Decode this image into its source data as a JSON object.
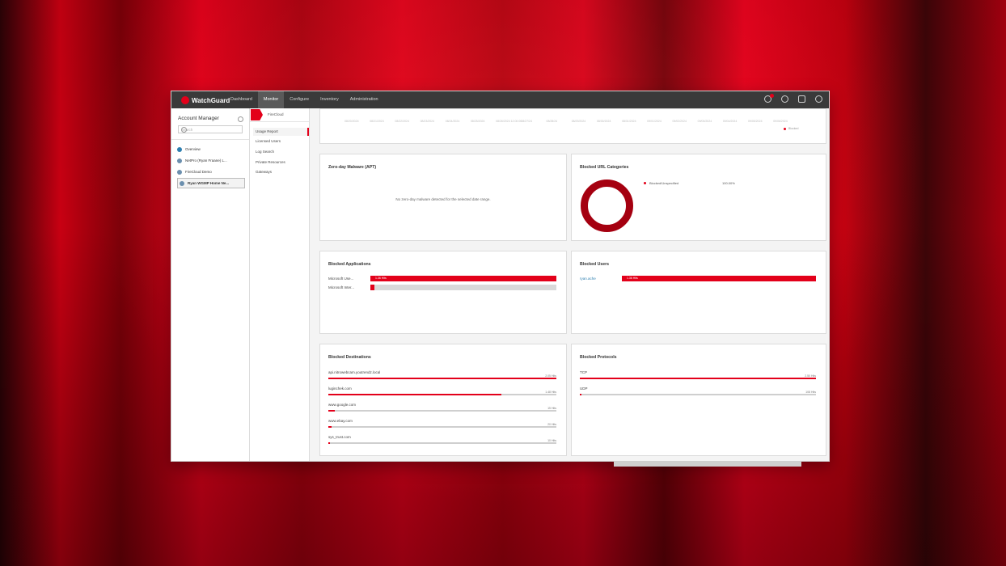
{
  "app": {
    "logo_text": "WatchGuard"
  },
  "nav": {
    "items": [
      "Dashboard",
      "Monitor",
      "Configure",
      "Inventory",
      "Administration"
    ],
    "active_index": 1
  },
  "top_icons": [
    "notifications-icon",
    "help-icon",
    "phone-icon",
    "globe-icon"
  ],
  "account_manager": {
    "title": "Account Manager",
    "search_placeholder": "Search",
    "accounts": [
      {
        "label": "Overview",
        "icon": "cloud-icon",
        "selected": false
      },
      {
        "label": "NetPro (Ryan Fraane) L...",
        "icon": "user-icon",
        "selected": false
      },
      {
        "label": "FireCloud Demo",
        "icon": "user-icon",
        "selected": false
      },
      {
        "label": "Ryan WGMP Home Ne...",
        "icon": "user-icon",
        "selected": true
      }
    ]
  },
  "submenu": {
    "header": "FireCloud",
    "items": [
      "Usage Report",
      "Licensed Users",
      "Log Search",
      "Private Resources",
      "Gateways"
    ],
    "active_index": 0
  },
  "cards": {
    "zero_day": {
      "title": "Zero-day Malware (APT)",
      "message": "No zero-day malware detected for the selected date range."
    },
    "url_categories": {
      "title": "Blocked URL Categories",
      "legend_label": "Blocked/Unspecified",
      "legend_pct": "100.00%",
      "share": 1.0
    },
    "blocked_applications": {
      "title": "Blocked Applications",
      "rows": [
        {
          "label": "Microsoft Use...",
          "value_label": "1.36 Hits",
          "fraction": 1.0
        },
        {
          "label": "Microsoft Inter...",
          "value_label": "",
          "fraction": 0.02
        }
      ]
    },
    "blocked_users": {
      "title": "Blocked Users",
      "rows": [
        {
          "label": "ryan.ache",
          "value_label": "1.36 Hits",
          "fraction": 1.0
        }
      ]
    },
    "blocked_destinations": {
      "title": "Blocked Destinations",
      "rows": [
        {
          "label": "api.nitrowebcam.youtrendz.local",
          "value_label": "2.05 Hits",
          "fraction": 1.0
        },
        {
          "label": "luginchek.com",
          "value_label": "1.48 Hits",
          "fraction": 0.76
        },
        {
          "label": "www.google.com",
          "value_label": "15 Hits",
          "fraction": 0.03
        },
        {
          "label": "www.ebay.com",
          "value_label": "20 Hits",
          "fraction": 0.015
        },
        {
          "label": "sys_trust.com",
          "value_label": "10 Hits",
          "fraction": 0.008
        }
      ]
    },
    "blocked_protocols": {
      "title": "Blocked Protocols",
      "rows": [
        {
          "label": "TCP",
          "value_label": "2.50 Hits",
          "fraction": 1.0
        },
        {
          "label": "UDP",
          "value_label": "108 Hits",
          "fraction": 0.006
        }
      ]
    }
  },
  "timeline": {
    "ticks": [
      "08/20/2024",
      "08/21/2024",
      "08/22/2024",
      "08/23/2024",
      "08/24/2024",
      "08/25/2024",
      "08/26/2024 12:00:00",
      "08/27/24",
      "08/28/24",
      "08/29/2024",
      "08/30/2024",
      "08/31/2024",
      "09/01/2024",
      "09/02/2024",
      "09/03/2024",
      "09/04/2024",
      "09/05/2024",
      "09/06/2024"
    ],
    "legend": "Blocked"
  },
  "colors": {
    "accent": "#e3001a",
    "donut": "#a50010",
    "topbar": "#3a3a3a"
  }
}
